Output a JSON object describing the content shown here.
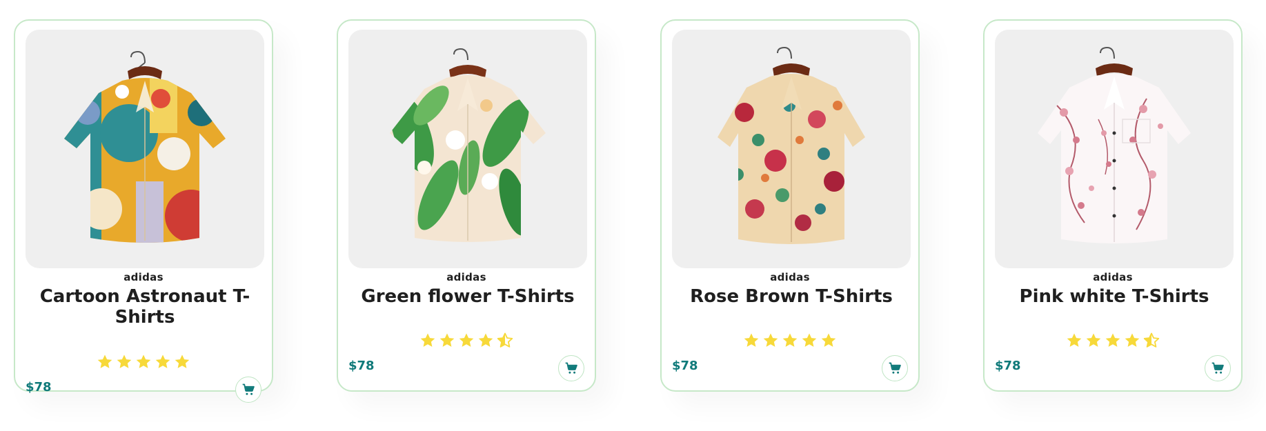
{
  "colors": {
    "card_border": "#c6e8c8",
    "price": "#107a7a",
    "star": "#f7d93a",
    "image_bg": "#efefef"
  },
  "products": [
    {
      "brand": "adidas",
      "name": "Cartoon Astronaut T-Shirts",
      "rating": 5,
      "price": "$78",
      "image": "cartoon-astronaut-shirt-image",
      "cart_icon": "cart-icon"
    },
    {
      "brand": "adidas",
      "name": "Green flower T-Shirts",
      "rating": 4.5,
      "price": "$78",
      "image": "green-flower-shirt-image",
      "cart_icon": "cart-icon"
    },
    {
      "brand": "adidas",
      "name": "Rose Brown T-Shirts",
      "rating": 5,
      "price": "$78",
      "image": "rose-brown-shirt-image",
      "cart_icon": "cart-icon"
    },
    {
      "brand": "adidas",
      "name": "Pink white T-Shirts",
      "rating": 4.5,
      "price": "$78",
      "image": "pink-white-shirt-image",
      "cart_icon": "cart-icon"
    }
  ]
}
